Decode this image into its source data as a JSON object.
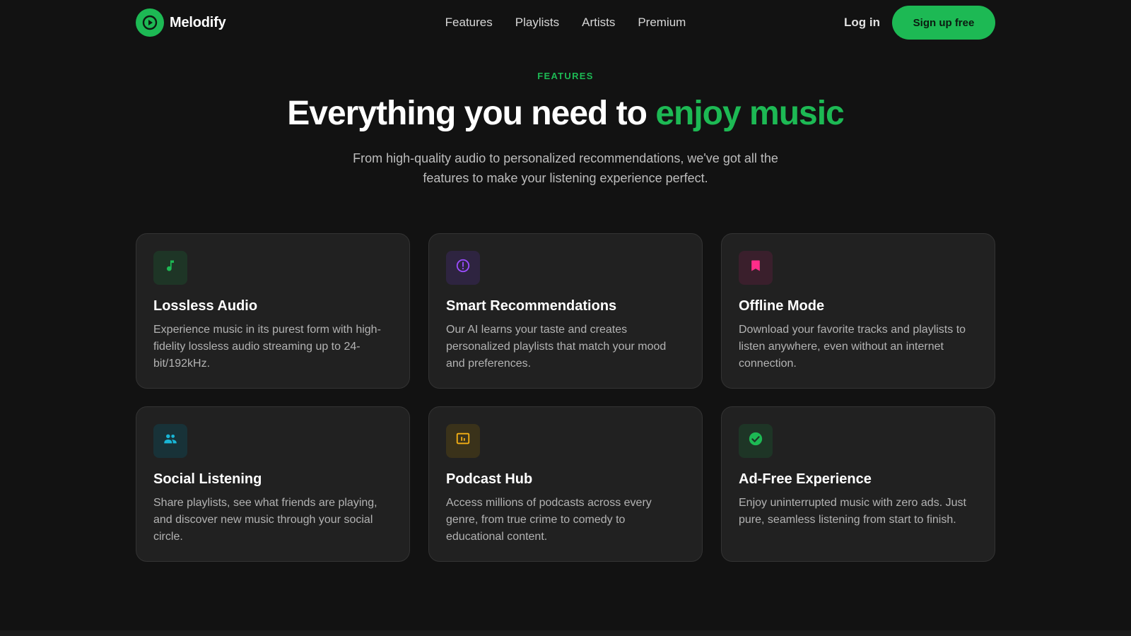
{
  "brand": {
    "name": "Melodify",
    "accent": "#1db954",
    "icon": "play-circle-icon"
  },
  "nav": {
    "links": [
      "Features",
      "Playlists",
      "Artists",
      "Premium"
    ],
    "login_label": "Log in",
    "signup_label": "Sign up free"
  },
  "hero": {
    "eyebrow": "FEATURES",
    "headline_main": "Everything you need to ",
    "headline_accent": "enjoy music",
    "subtitle": "From high-quality audio to personalized recommendations, we've got all the features to make your listening experience perfect."
  },
  "features": [
    {
      "title": "Lossless Audio",
      "description": "Experience music in its purest form with high-fidelity lossless audio streaming up to 24-bit/192kHz.",
      "icon": "music-note-icon",
      "color": "#1db954",
      "bg": "#1e3526"
    },
    {
      "title": "Smart Recommendations",
      "description": "Our AI learns your taste and creates personalized playlists that match your mood and preferences.",
      "icon": "alert-circle-icon",
      "color": "#9b4dff",
      "bg": "#2e2440"
    },
    {
      "title": "Offline Mode",
      "description": "Download your favorite tracks and playlists to listen anywhere, even without an internet connection.",
      "icon": "bookmark-icon",
      "color": "#ff2d8a",
      "bg": "#3a1f2c"
    },
    {
      "title": "Social Listening",
      "description": "Share playlists, see what friends are playing, and discover new music through your social circle.",
      "icon": "people-icon",
      "color": "#19b6d6",
      "bg": "#183238"
    },
    {
      "title": "Podcast Hub",
      "description": "Access millions of podcasts across every genre, from true crime to comedy to educational content.",
      "icon": "podcast-icon",
      "color": "#f5b014",
      "bg": "#3a321a"
    },
    {
      "title": "Ad-Free Experience",
      "description": "Enjoy uninterrupted music with zero ads. Just pure, seamless listening from start to finish.",
      "icon": "check-circle-icon",
      "color": "#1db954",
      "bg": "#1e3526"
    }
  ]
}
